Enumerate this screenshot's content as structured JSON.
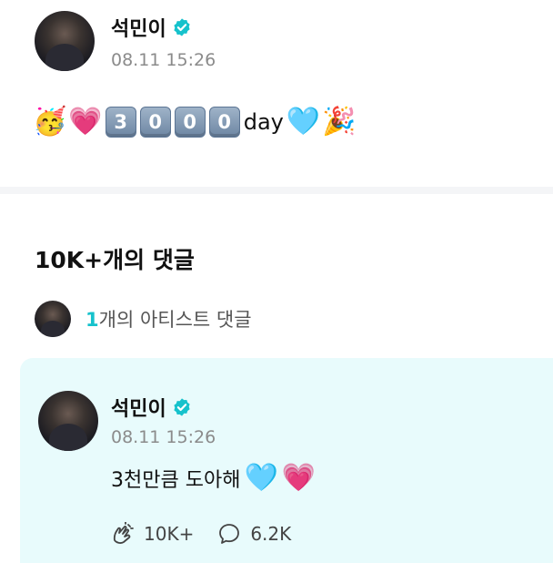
{
  "post": {
    "author": "석민이",
    "timestamp": "08.11 15:26",
    "content": {
      "emoji_lead": [
        "🥳",
        "💗"
      ],
      "keycaps": [
        "3",
        "0",
        "0",
        "0"
      ],
      "word": "day",
      "emoji_trail": [
        "🩵",
        "🎉"
      ]
    }
  },
  "comments": {
    "count_label": "10K+개의 댓글",
    "artist_count": "1",
    "artist_label": "개의 아티스트 댓글"
  },
  "artist_comment": {
    "author": "석민이",
    "timestamp": "08.11 15:26",
    "text": "3천만큼 도아해",
    "emoji_trail": [
      "🩵",
      "💗"
    ],
    "likes": "10K+",
    "replies": "6.2K"
  },
  "colors": {
    "accent": "#16c2cc",
    "card_bg": "#e8fbfc",
    "timestamp": "#8b8b8b"
  },
  "icons": {
    "verified": "verified-badge-icon",
    "like": "like-hand-icon",
    "reply": "reply-bubble-icon"
  }
}
